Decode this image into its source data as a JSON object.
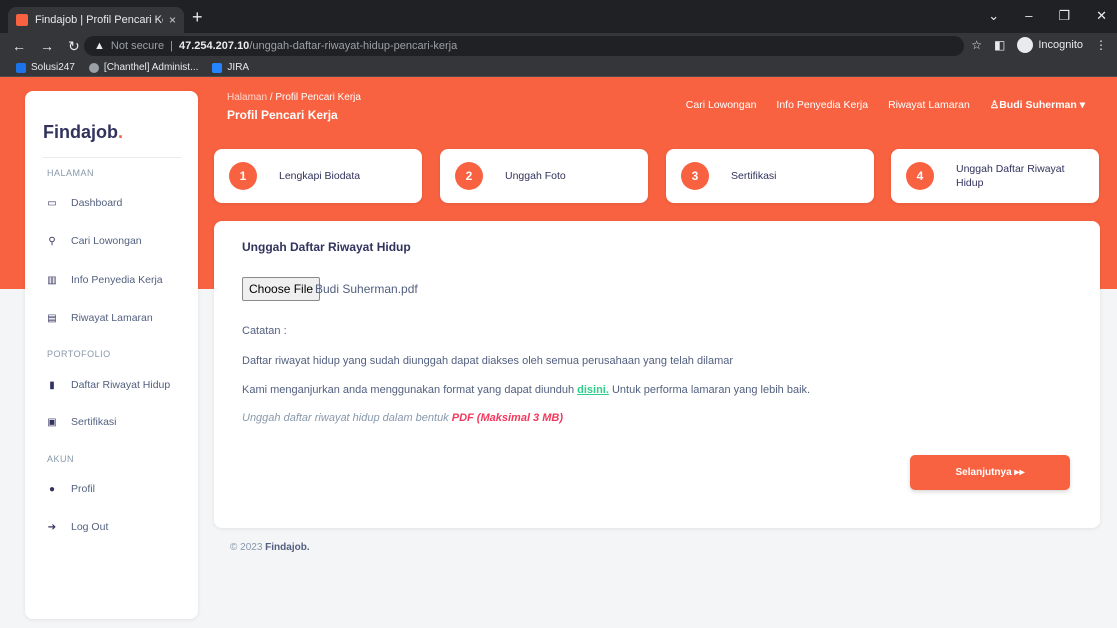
{
  "browser": {
    "tab_title": "Findajob | Profil Pencari Kerja",
    "tab_close": "×",
    "new_tab": "+",
    "security": "Not secure",
    "url_host": "47.254.207.10",
    "url_path": "/unggah-daftar-riwayat-hidup-pencari-kerja",
    "incognito": "Incognito",
    "bookmarks": [
      "Solusi247",
      "[Chanthel] Administ...",
      "JIRA"
    ]
  },
  "sidebar": {
    "brand": "Findajob",
    "brand_dot": ".",
    "section_halaman": "HALAMAN",
    "section_portofolio": "PORTOFOLIO",
    "section_akun": "AKUN",
    "items": [
      {
        "label": "Dashboard",
        "icon": "monitor-icon"
      },
      {
        "label": "Cari Lowongan",
        "icon": "search-icon"
      },
      {
        "label": "Info Penyedia Kerja",
        "icon": "building-icon"
      },
      {
        "label": "Riwayat Lamaran",
        "icon": "document-icon"
      },
      {
        "label": "Daftar Riwayat Hidup",
        "icon": "file-icon"
      },
      {
        "label": "Sertifikasi",
        "icon": "certificate-icon"
      },
      {
        "label": "Profil",
        "icon": "user-icon"
      },
      {
        "label": "Log Out",
        "icon": "logout-icon"
      }
    ]
  },
  "header": {
    "crumb_root": "Halaman",
    "crumb_sep": "/",
    "crumb_current": "Profil Pencari Kerja",
    "title": "Profil Pencari Kerja",
    "nav": [
      "Cari Lowongan",
      "Info Penyedia Kerja",
      "Riwayat Lamaran"
    ],
    "user": "Budi Suherman"
  },
  "steps": [
    {
      "num": "1",
      "label": "Lengkapi Biodata"
    },
    {
      "num": "2",
      "label": "Unggah Foto"
    },
    {
      "num": "3",
      "label": "Sertifikasi"
    },
    {
      "num": "4",
      "label": "Unggah Daftar Riwayat Hidup"
    }
  ],
  "upload": {
    "heading": "Unggah Daftar Riwayat Hidup",
    "choose_file": "Choose File",
    "file_name": "Budi Suherman.pdf",
    "note_label": "Catatan :",
    "note_1": "Daftar riwayat hidup yang sudah diunggah dapat diakses oleh semua perusahaan yang telah dilamar",
    "note_2_before": "Kami menganjurkan anda menggunakan format yang dapat diunduh ",
    "note_2_link": "disini.",
    "note_2_after": " Untuk performa lamaran yang lebih baik.",
    "hint_before": "Unggah daftar riwayat hidup dalam bentuk ",
    "hint_emph": "PDF (Maksimal 3 MB)",
    "next_button": "Selanjutnya ▸▸"
  },
  "footer": {
    "copyright": "© 2023 ",
    "brand": "Findajob."
  },
  "colors": {
    "accent": "#f86241",
    "success": "#2dce89",
    "danger": "#f5365c"
  }
}
